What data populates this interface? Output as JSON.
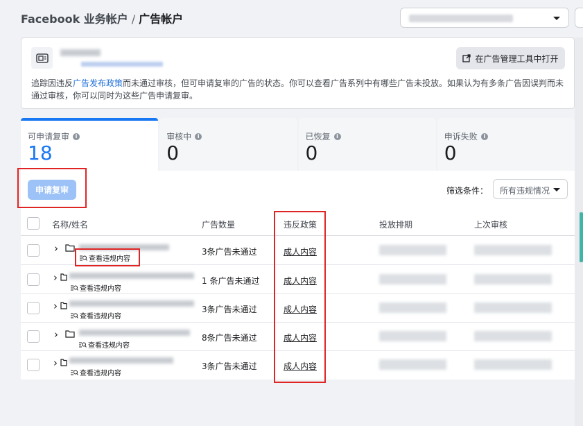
{
  "breadcrumb": {
    "root": "Facebook 业务帐户",
    "separator": "/",
    "current": "广告帐户"
  },
  "info": {
    "open_button": "在广告管理工具中打开",
    "desc_prefix": "追踪因违反",
    "desc_link": "广告发布政策",
    "desc_suffix": "而未通过审核，但可申请复审的广告的状态。你可以查看广告系列中有哪些广告未投放。如果认为有多条广告因误判而未通过审核，你可以同时为这些广告申请复审。"
  },
  "tabs": [
    {
      "label": "可申请复审",
      "count": "18"
    },
    {
      "label": "审核中",
      "count": "0"
    },
    {
      "label": "已恢复",
      "count": "0"
    },
    {
      "label": "申诉失败",
      "count": "0"
    }
  ],
  "toolbar": {
    "appeal_button": "申请复审",
    "filter_label": "筛选条件：",
    "filter_value": "所有违规情况"
  },
  "table": {
    "headers": [
      "名称/姓名",
      "广告数量",
      "违反政策",
      "投放排期",
      "上次审核"
    ],
    "rows": [
      {
        "view_label": "查看违规内容",
        "count": "3条广告未通过",
        "policy": "成人内容"
      },
      {
        "view_label": "查看违规内容",
        "count": "1 条广告未通过",
        "policy": "成人内容"
      },
      {
        "view_label": "查看违规内容",
        "count": "3条广告未通过",
        "policy": "成人内容"
      },
      {
        "view_label": "查看违规内容",
        "count": "8条广告未通过",
        "policy": "成人内容"
      },
      {
        "view_label": "查看违规内容",
        "count": "3条广告未通过",
        "policy": "成人内容"
      }
    ]
  },
  "colors": {
    "accent": "#1877f2",
    "highlight": "#e02424",
    "disabled_button": "#9cc2f7",
    "link": "#216fdb"
  }
}
